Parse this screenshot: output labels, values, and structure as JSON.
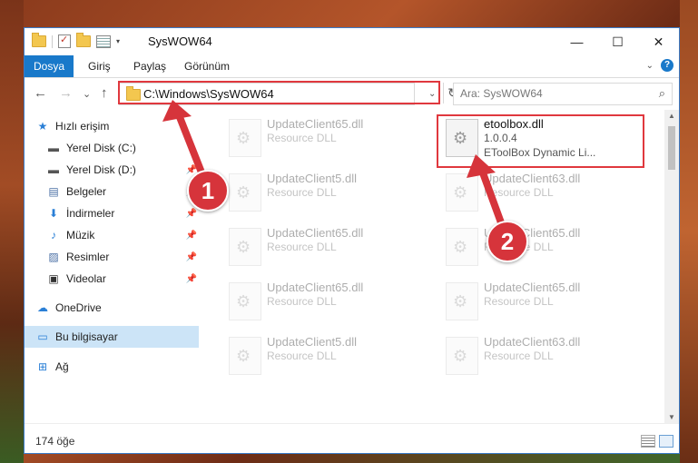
{
  "window": {
    "title": "SysWOW64",
    "minimize": "—",
    "maximize": "☐",
    "close": "✕"
  },
  "ribbon": {
    "tabs": [
      "Dosya",
      "Giriş",
      "Paylaş",
      "Görünüm"
    ],
    "expand": "⌄",
    "help": "?"
  },
  "nav": {
    "back": "←",
    "forward": "→",
    "recent": "⌄",
    "up": "↑",
    "address": "C:\\Windows\\SysWOW64",
    "search_placeholder": "Ara: SysWOW64"
  },
  "sidebar": {
    "items": [
      {
        "label": "Hızlı erişim",
        "icon": "star-icon"
      },
      {
        "label": "Yerel Disk (C:)",
        "icon": "drive-icon"
      },
      {
        "label": "Yerel Disk (D:)",
        "icon": "drive-icon"
      },
      {
        "label": "Belgeler",
        "icon": "documents-icon"
      },
      {
        "label": "İndirmeler",
        "icon": "download-icon"
      },
      {
        "label": "Müzik",
        "icon": "music-icon"
      },
      {
        "label": "Resimler",
        "icon": "pictures-icon"
      },
      {
        "label": "Videolar",
        "icon": "video-icon"
      },
      {
        "label": "OneDrive",
        "icon": "cloud-icon"
      },
      {
        "label": "Bu bilgisayar",
        "icon": "computer-icon"
      },
      {
        "label": "Ağ",
        "icon": "network-icon"
      }
    ]
  },
  "files": [
    {
      "name": "UpdateClient65.dll",
      "sub": "Resource DLL"
    },
    {
      "name": "etoolbox.dll",
      "version": "1.0.0.4",
      "sub": "EToolBox Dynamic Li..."
    },
    {
      "name": "UpdateClient5.dll",
      "sub": "Resource DLL"
    },
    {
      "name": "UpdateClient63.dll",
      "sub": "Resource DLL"
    },
    {
      "name": "UpdateClient65.dll",
      "sub": "Resource DLL"
    },
    {
      "name": "UpdateClient65.dll",
      "sub": "Resource DLL"
    },
    {
      "name": "UpdateClient65.dll",
      "sub": "Resource DLL"
    },
    {
      "name": "UpdateClient65.dll",
      "sub": "Resource DLL"
    },
    {
      "name": "UpdateClient5.dll",
      "sub": "Resource DLL"
    },
    {
      "name": "UpdateClient63.dll",
      "sub": "Resource DLL"
    }
  ],
  "status": {
    "count": "174 öğe"
  },
  "callouts": [
    "1",
    "2"
  ],
  "colors": {
    "accent": "#1979ca",
    "highlight": "#e0383e",
    "selected": "#cce4f7"
  }
}
